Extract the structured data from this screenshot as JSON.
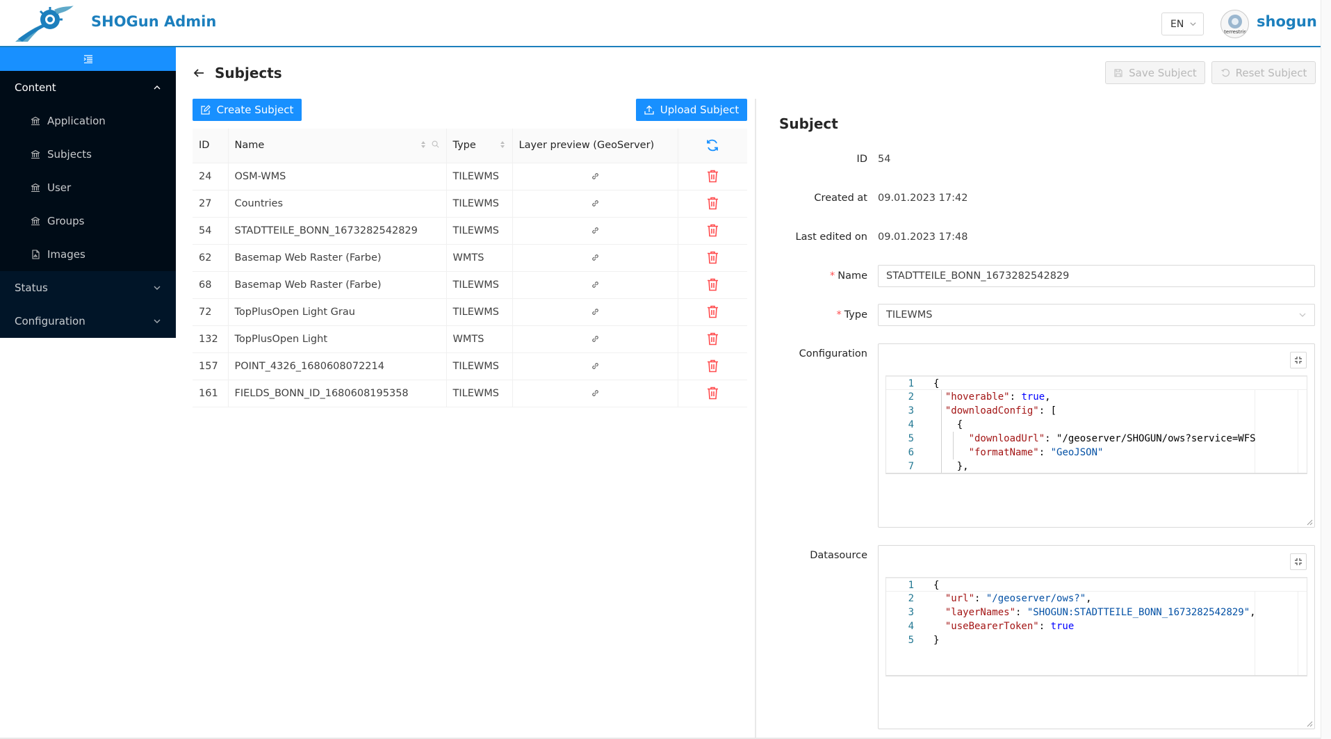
{
  "header": {
    "app_title": "SHOGun Admin",
    "language": "EN",
    "user_name": "shogun",
    "avatar_text": "terrestris",
    "brand_color": "#1c7fbd"
  },
  "sidebar": {
    "groups": [
      {
        "label": "Content",
        "expanded": true
      },
      {
        "label": "Status",
        "expanded": false
      },
      {
        "label": "Configuration",
        "expanded": false
      }
    ],
    "items": [
      {
        "label": "Application",
        "icon": "bank-icon"
      },
      {
        "label": "Subjects",
        "icon": "bank-icon"
      },
      {
        "label": "User",
        "icon": "bank-icon"
      },
      {
        "label": "Groups",
        "icon": "bank-icon"
      },
      {
        "label": "Images",
        "icon": "file-image-icon"
      }
    ]
  },
  "page": {
    "title": "Subjects",
    "save_label": "Save Subject",
    "reset_label": "Reset Subject",
    "create_label": "Create Subject",
    "upload_label": "Upload Subject"
  },
  "table": {
    "columns": [
      "ID",
      "Name",
      "Type",
      "Layer preview (GeoServer)"
    ],
    "rows": [
      {
        "id": "24",
        "name": "OSM-WMS",
        "type": "TILEWMS"
      },
      {
        "id": "27",
        "name": "Countries",
        "type": "TILEWMS"
      },
      {
        "id": "54",
        "name": "STADTTEILE_BONN_1673282542829",
        "type": "TILEWMS"
      },
      {
        "id": "62",
        "name": "Basemap Web Raster (Farbe)",
        "type": "WMTS"
      },
      {
        "id": "68",
        "name": "Basemap Web Raster (Farbe)",
        "type": "TILEWMS"
      },
      {
        "id": "72",
        "name": "TopPlusOpen Light Grau",
        "type": "TILEWMS"
      },
      {
        "id": "132",
        "name": "TopPlusOpen Light",
        "type": "WMTS"
      },
      {
        "id": "157",
        "name": "POINT_4326_1680608072214",
        "type": "TILEWMS"
      },
      {
        "id": "161",
        "name": "FIELDS_BONN_ID_1680608195358",
        "type": "TILEWMS"
      }
    ]
  },
  "form": {
    "title": "Subject",
    "id_label": "ID",
    "id_value": "54",
    "created_label": "Created at",
    "created_value": "09.01.2023 17:42",
    "edited_label": "Last edited on",
    "edited_value": "09.01.2023 17:48",
    "name_label": "Name",
    "name_value": "STADTTEILE_BONN_1673282542829",
    "type_label": "Type",
    "type_value": "TILEWMS",
    "config_label": "Configuration",
    "datasource_label": "Datasource",
    "config_code": [
      {
        "n": "1",
        "t": "{"
      },
      {
        "n": "2",
        "t": "  \"hoverable\": true,"
      },
      {
        "n": "3",
        "t": "  \"downloadConfig\": ["
      },
      {
        "n": "4",
        "t": "    {"
      },
      {
        "n": "5",
        "t": "      \"downloadUrl\": \"/geoserver/SHOGUN/ows?service=WFS"
      },
      {
        "n": "6",
        "t": "      \"formatName\": \"GeoJSON\""
      },
      {
        "n": "7",
        "t": "    },"
      }
    ],
    "datasource_code": [
      {
        "n": "1",
        "t": "{"
      },
      {
        "n": "2",
        "t": "  \"url\": \"/geoserver/ows?\","
      },
      {
        "n": "3",
        "t": "  \"layerNames\": \"SHOGUN:STADTTEILE_BONN_1673282542829\","
      },
      {
        "n": "4",
        "t": "  \"useBearerToken\": true"
      },
      {
        "n": "5",
        "t": "}"
      }
    ]
  },
  "colors": {
    "primary": "#1890ff",
    "sidebar_bg": "#011528",
    "danger": "#ff4d4f"
  }
}
